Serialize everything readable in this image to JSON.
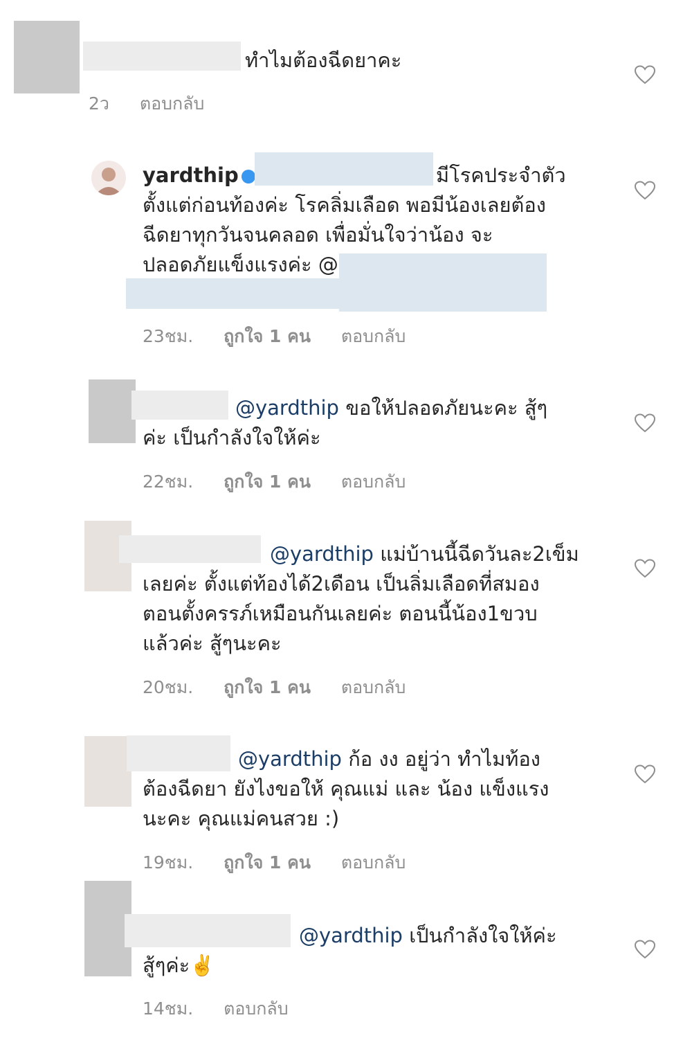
{
  "comments": [
    {
      "text": "ทำไมต้องฉีดยาคะ",
      "time": "2ว",
      "reply": "ตอบกลับ"
    },
    {
      "username": "yardthip",
      "lines": [
        "มีโรคประจำตัว",
        "ตั้งแต่ก่อนท้องค่ะ โรคลิ่มเลือด พอมีน้องเลยต้อง",
        "ฉีดยาทุกวันจนคลอด เพื่อมั่นใจว่าน้อง จะ",
        "ปลอดภัยแข็งแรงค่ะ @"
      ],
      "time": "23ชม.",
      "likes": "ถูกใจ 1 คน",
      "reply": "ตอบกลับ"
    },
    {
      "mention": "@yardthip",
      "lines": [
        "ขอให้ปลอดภัยนะคะ สู้ๆ",
        "ค่ะ เป็นกำลังใจให้ค่ะ"
      ],
      "time": "22ชม.",
      "likes": "ถูกใจ 1 คน",
      "reply": "ตอบกลับ"
    },
    {
      "mention": "@yardthip",
      "lines": [
        "แม่บ้านนี้ฉีดวันละ2เข็ม",
        "เลยค่ะ ตั้งแต่ท้องได้2เดือน เป็นลิ่มเลือดที่สมอง",
        "ตอนตั้งครรภ์เหมือนกันเลยค่ะ ตอนนี้น้อง1ขวบ",
        "แล้วค่ะ สู้ๆนะคะ"
      ],
      "time": "20ชม.",
      "likes": "ถูกใจ 1 คน",
      "reply": "ตอบกลับ"
    },
    {
      "mention": "@yardthip",
      "lines": [
        "ก้อ งง อยู่ว่า ทำไมท้อง",
        "ต้องฉีดยา  ยังไงขอให้ คุณแม่ และ น้อง แข็งแรง",
        "นะคะ  คุณแม่คนสวย :)"
      ],
      "time": "19ชม.",
      "likes": "ถูกใจ 1 คน",
      "reply": "ตอบกลับ"
    },
    {
      "mention": "@yardthip",
      "lines": [
        "เป็นกำลังใจให้ค่ะ",
        "สู้ๆค่ะ✌️"
      ],
      "time": "14ชม.",
      "reply": "ตอบกลับ"
    }
  ]
}
